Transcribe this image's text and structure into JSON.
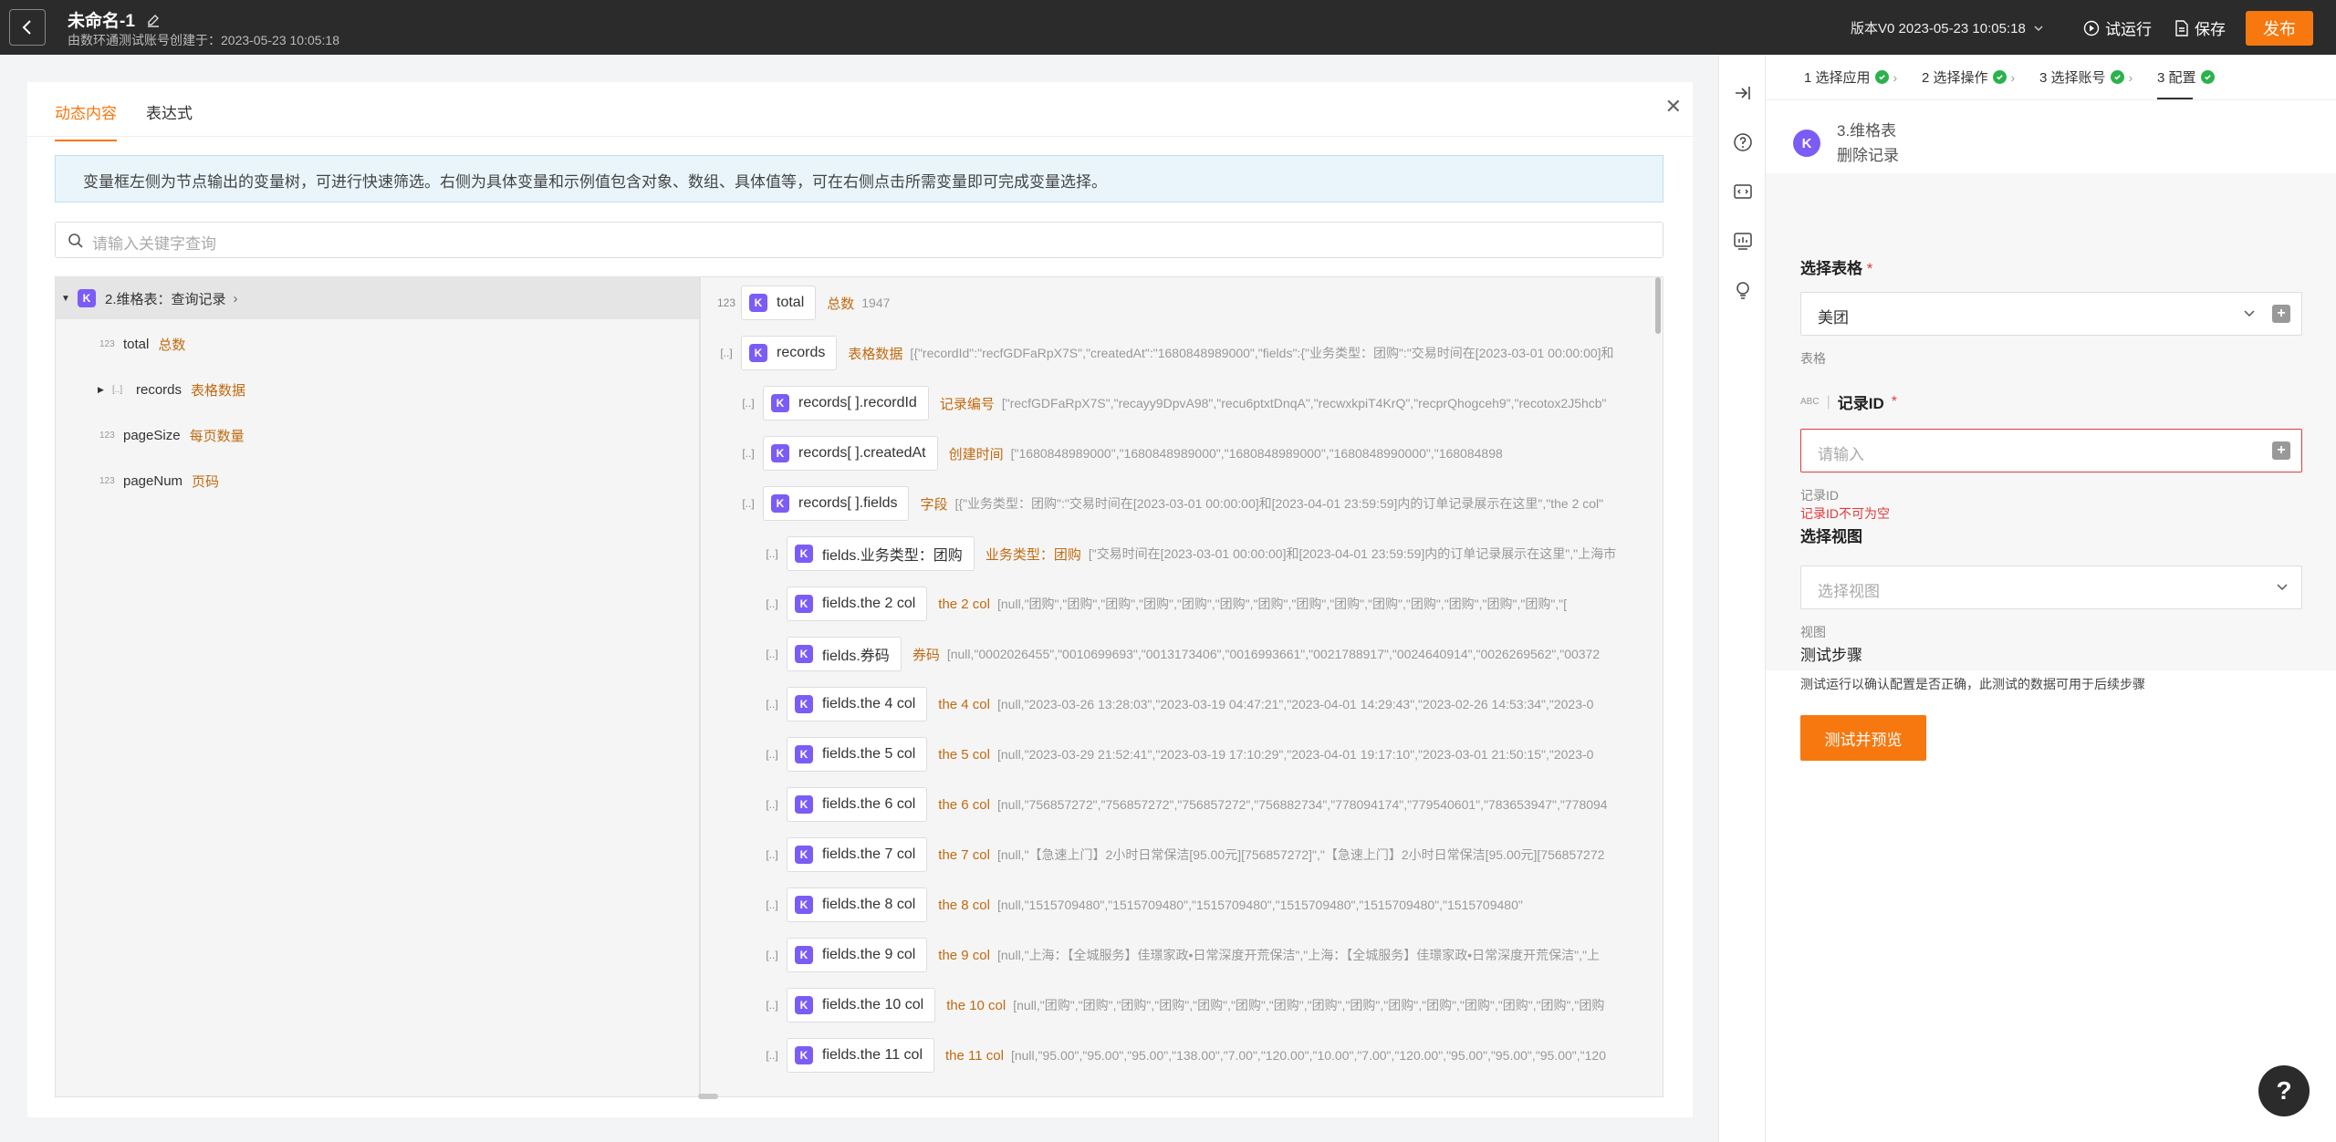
{
  "header": {
    "title": "未命名-1",
    "subtitle": "由数环通测试账号创建于：2023-05-23 10:05:18",
    "version": "版本V0 2023-05-23 10:05:18",
    "trial_run": "试运行",
    "save": "保存",
    "publish": "发布"
  },
  "modal": {
    "tabs": [
      "动态内容",
      "表达式"
    ],
    "info": "变量框左侧为节点输出的变量树，可进行快速筛选。右侧为具体变量和示例值包含对象、数组、具体值等，可在右侧点击所需变量即可完成变量选择。",
    "search_placeholder": "请输入关键字查询",
    "tree": [
      {
        "label": "2.维格表：查询记录",
        "type": ""
      },
      {
        "label": "total",
        "cn": "总数",
        "type": "123"
      },
      {
        "label": "records",
        "cn": "表格数据",
        "type": "[..]"
      },
      {
        "label": "pageSize",
        "cn": "每页数量",
        "type": "123"
      },
      {
        "label": "pageNum",
        "cn": "页码",
        "type": "123"
      }
    ],
    "values": [
      {
        "type": "123",
        "label": "total",
        "cn": "总数",
        "sample": "1947"
      },
      {
        "type": "[..]",
        "label": "records",
        "cn": "表格数据",
        "sample": "[{\"recordId\":\"recfGDFaRpX7S\",\"createdAt\":\"1680848989000\",\"fields\":{\"业务类型：团购\":\"交易时间在[2023-03-01 00:00:00]和"
      },
      {
        "type": "[..]",
        "label": "records[ ].recordId",
        "cn": "记录编号",
        "sample": "[\"recfGDFaRpX7S\",\"recayy9DpvA98\",\"recu6ptxtDnqA\",\"recwxkpiT4KrQ\",\"recprQhogceh9\",\"recotox2J5hcb\""
      },
      {
        "type": "[..]",
        "label": "records[ ].createdAt",
        "cn": "创建时间",
        "sample": "[\"1680848989000\",\"1680848989000\",\"1680848989000\",\"1680848990000\",\"168084898"
      },
      {
        "type": "[..]",
        "label": "records[ ].fields",
        "cn": "字段",
        "sample": "[{\"业务类型：团购\":\"交易时间在[2023-03-01 00:00:00]和[2023-04-01 23:59:59]内的订单记录展示在这里\",\"the 2 col\""
      },
      {
        "type": "[..]",
        "label": "fields.业务类型：团购",
        "cn": "业务类型：团购",
        "sample": "[\"交易时间在[2023-03-01 00:00:00]和[2023-04-01 23:59:59]内的订单记录展示在这里\",\"上海市"
      },
      {
        "type": "[..]",
        "label": "fields.the 2 col",
        "cn": "the 2 col",
        "sample": "[null,\"团购\",\"团购\",\"团购\",\"团购\",\"团购\",\"团购\",\"团购\",\"团购\",\"团购\",\"团购\",\"团购\",\"团购\",\"团购\",\"团购\",\"["
      },
      {
        "type": "[..]",
        "label": "fields.券码",
        "cn": "券码",
        "sample": "[null,\"0002026455\",\"0010699693\",\"0013173406\",\"0016993661\",\"0021788917\",\"0024640914\",\"0026269562\",\"00372"
      },
      {
        "type": "[..]",
        "label": "fields.the 4 col",
        "cn": "the 4 col",
        "sample": "[null,\"2023-03-26 13:28:03\",\"2023-03-19 04:47:21\",\"2023-04-01 14:29:43\",\"2023-02-26 14:53:34\",\"2023-0"
      },
      {
        "type": "[..]",
        "label": "fields.the 5 col",
        "cn": "the 5 col",
        "sample": "[null,\"2023-03-29 21:52:41\",\"2023-03-19 17:10:29\",\"2023-04-01 19:17:10\",\"2023-03-01 21:50:15\",\"2023-0"
      },
      {
        "type": "[..]",
        "label": "fields.the 6 col",
        "cn": "the 6 col",
        "sample": "[null,\"756857272\",\"756857272\",\"756857272\",\"756882734\",\"778094174\",\"779540601\",\"783653947\",\"778094"
      },
      {
        "type": "[..]",
        "label": "fields.the 7 col",
        "cn": "the 7 col",
        "sample": "[null,\"【急速上门】2小时日常保洁[95.00元][756857272]\",\"【急速上门】2小时日常保洁[95.00元][756857272"
      },
      {
        "type": "[..]",
        "label": "fields.the 8 col",
        "cn": "the 8 col",
        "sample": "[null,\"1515709480\",\"1515709480\",\"1515709480\",\"1515709480\",\"1515709480\",\"1515709480\""
      },
      {
        "type": "[..]",
        "label": "fields.the 9 col",
        "cn": "the 9 col",
        "sample": "[null,\"上海：【全城服务】佳璟家政•日常深度开荒保洁\",\"上海：【全城服务】佳璟家政•日常深度开荒保洁\",\"上"
      },
      {
        "type": "[..]",
        "label": "fields.the 10 col",
        "cn": "the 10 col",
        "sample": "[null,\"团购\",\"团购\",\"团购\",\"团购\",\"团购\",\"团购\",\"团购\",\"团购\",\"团购\",\"团购\",\"团购\",\"团购\",\"团购\",\"团购\",\"团购"
      },
      {
        "type": "[..]",
        "label": "fields.the 11 col",
        "cn": "the 11 col",
        "sample": "[null,\"95.00\",\"95.00\",\"95.00\",\"138.00\",\"7.00\",\"120.00\",\"10.00\",\"7.00\",\"120.00\",\"95.00\",\"95.00\",\"95.00\",\"120"
      }
    ]
  },
  "right": {
    "steps": [
      "1 选择应用",
      "2 选择操作",
      "3 选择账号",
      "3 配置"
    ],
    "node_title": "3.维格表",
    "node_action": "删除记录",
    "table_label": "选择表格",
    "table_value": "美团",
    "table_helper": "表格",
    "record_type": "ABC",
    "record_label": "记录ID",
    "record_placeholder": "请输入",
    "record_helper": "记录ID",
    "record_error": "记录ID不可为空",
    "view_label": "选择视图",
    "view_placeholder": "选择视图",
    "view_helper": "视图",
    "test_title": "测试步骤",
    "test_desc": "测试运行以确认配置是否正确，此测试的数据可用于后续步骤",
    "test_button": "测试并预览"
  },
  "colors": {
    "accent": "#f7780f",
    "purple": "#7c5cf6",
    "success": "#2bb24c",
    "error": "#e23b3b"
  }
}
